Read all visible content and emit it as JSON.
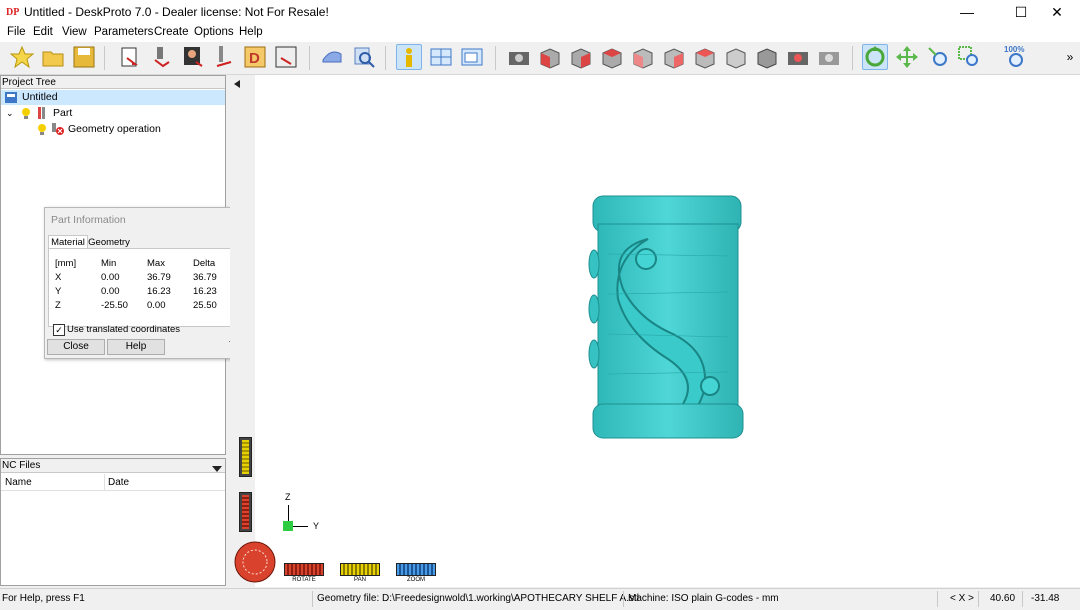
{
  "window": {
    "title": "Untitled - DeskProto 7.0 - Dealer license: Not For Resale!",
    "app_icon_text": "DP",
    "controls": {
      "minimize": "—",
      "maximize": "☐",
      "close": "✕"
    }
  },
  "menu": [
    "File",
    "Edit",
    "View",
    "Parameters",
    "Create",
    "Options",
    "Help"
  ],
  "toolbar": {
    "zoom_label": "100%",
    "overflow": "»",
    "colors": {
      "accent_blue": "#cce4f7",
      "model": "#3ec9c9"
    }
  },
  "project_tree": {
    "header": "Project Tree",
    "root": "Untitled",
    "part": "Part",
    "operation": "Geometry operation"
  },
  "part_info": {
    "title": "Part Information",
    "tabs": [
      "Material",
      "Geometry"
    ],
    "headers": [
      "[mm]",
      "Min",
      "Max",
      "Delta"
    ],
    "rows": [
      {
        "axis": "X",
        "min": "0.00",
        "max": "36.79",
        "delta": "36.79"
      },
      {
        "axis": "Y",
        "min": "0.00",
        "max": "16.23",
        "delta": "16.23"
      },
      {
        "axis": "Z",
        "min": "-25.50",
        "max": "0.00",
        "delta": "25.50"
      }
    ],
    "checkbox_label": "Use translated coordinates",
    "close_button": "Close",
    "help_button": "Help"
  },
  "nc_files": {
    "header": "NC Files",
    "col_name": "Name",
    "col_date": "Date"
  },
  "viewport": {
    "axis_z": "Z",
    "axis_y": "Y",
    "rotate_label": "ROTATE",
    "pan_label": "PAN",
    "zoom_label": "ZOOM"
  },
  "status": {
    "help": "For Help, press F1",
    "geometry_file": "Geometry file: D:\\Freedesignwold\\1.working\\APOTHECARY SHELF A.stl",
    "machine": "Machine: ISO plain G-codes - mm",
    "axis_toggle": "< X >",
    "coord_1": "40.60",
    "coord_2": "-31.48"
  }
}
